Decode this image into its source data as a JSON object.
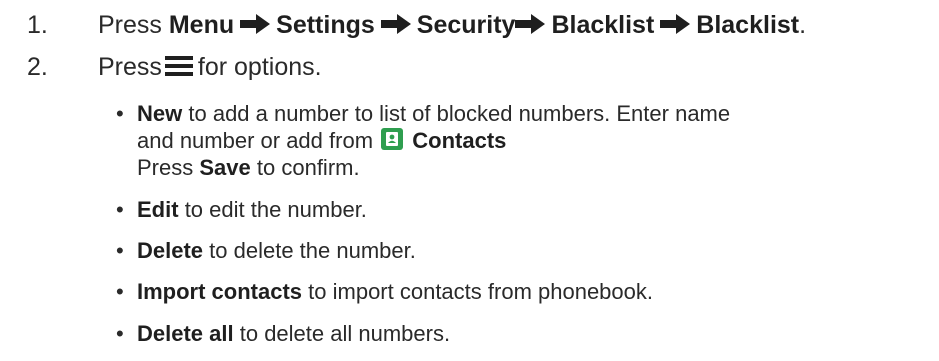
{
  "steps": [
    {
      "number": "1.",
      "press": "Press",
      "path": [
        "Menu",
        "Settings",
        "Security",
        "Blacklist",
        "Blacklist"
      ],
      "end": "."
    },
    {
      "number": "2.",
      "press": "Press",
      "icon": "hamburger-menu-icon",
      "suffix": "for options."
    }
  ],
  "bullets": [
    {
      "marker": "•",
      "term": "New",
      "line1": "to add a number to list of blocked numbers. Enter name",
      "line2_prefix": "and number or add from",
      "icon": "contacts-icon",
      "line2_term": "Contacts",
      "line3_press": "Press",
      "line3_term": "Save",
      "line3_suffix": "to confirm."
    },
    {
      "marker": "•",
      "term": "Edit",
      "text": "to edit the number."
    },
    {
      "marker": "•",
      "term": "Delete",
      "text": "to delete the number."
    },
    {
      "marker": "•",
      "term": "Import contacts",
      "text": "to import contacts from phonebook."
    },
    {
      "marker": "•",
      "term": "Delete all",
      "text": "to delete all numbers."
    }
  ],
  "colors": {
    "text": "#2a2a2a",
    "contacts_icon": "#2e9e4f"
  }
}
